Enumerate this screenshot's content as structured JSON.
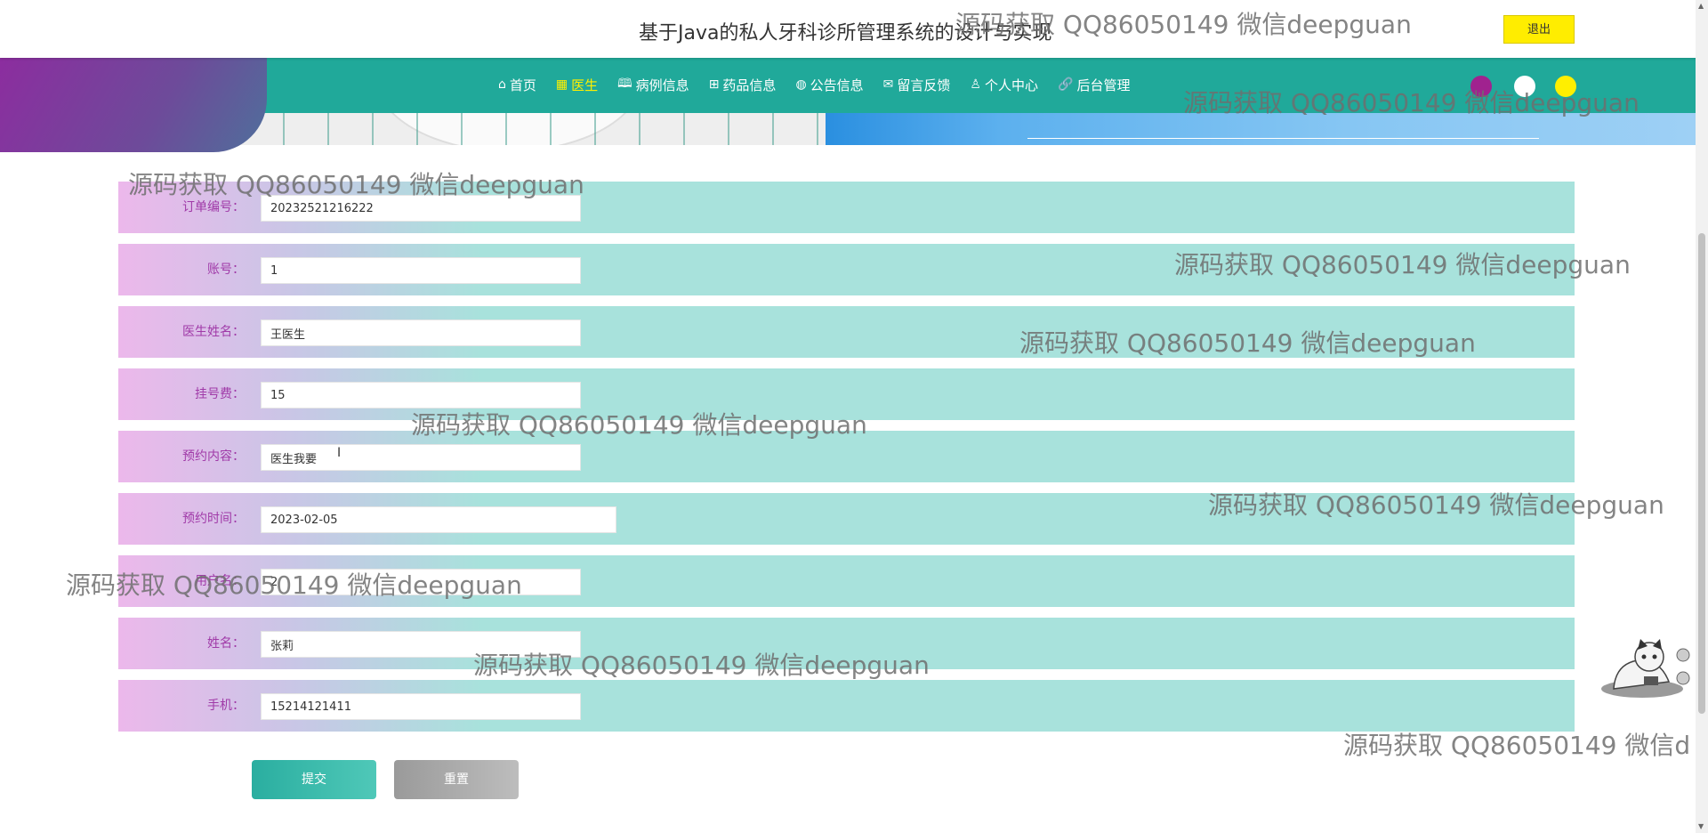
{
  "header": {
    "title": "基于Java的私人牙科诊所管理系统的设计与实现",
    "logout_label": "退出"
  },
  "nav": {
    "items": [
      {
        "icon": "home-icon",
        "glyph": "⌂",
        "label": "首页",
        "active": false
      },
      {
        "icon": "doctor-icon",
        "glyph": "▦",
        "label": "医生",
        "active": true
      },
      {
        "icon": "book-icon",
        "glyph": "🕮",
        "label": "病例信息",
        "active": false
      },
      {
        "icon": "gift-icon",
        "glyph": "⊞",
        "label": "药品信息",
        "active": false
      },
      {
        "icon": "globe-icon",
        "glyph": "◍",
        "label": "公告信息",
        "active": false
      },
      {
        "icon": "mail-icon",
        "glyph": "✉",
        "label": "留言反馈",
        "active": false
      },
      {
        "icon": "user-icon",
        "glyph": "♙",
        "label": "个人中心",
        "active": false
      },
      {
        "icon": "link-icon",
        "glyph": "🔗",
        "label": "后台管理",
        "active": false
      }
    ],
    "theme_dots": [
      "#a0228f",
      "#ffffff",
      "#ffef00"
    ],
    "active_color": "#ffef00"
  },
  "form": {
    "fields": [
      {
        "label": "订单编号：",
        "value": "20232521216222"
      },
      {
        "label": "账号：",
        "value": "1"
      },
      {
        "label": "医生姓名：",
        "value": "王医生"
      },
      {
        "label": "挂号费：",
        "value": "15"
      },
      {
        "label": "预约内容：",
        "value": "医生我要"
      },
      {
        "label": "预约时间：",
        "value": "2023-02-05"
      },
      {
        "label": "用户名：",
        "value": "2"
      },
      {
        "label": "姓名：",
        "value": "张莉"
      },
      {
        "label": "手机：",
        "value": "15214121411"
      }
    ],
    "submit_label": "提交",
    "reset_label": "重置"
  },
  "watermark": {
    "text": "源码获取 QQ86050149 微信deepguan",
    "text_cut": "源码获取 QQ86050149 微信d"
  }
}
